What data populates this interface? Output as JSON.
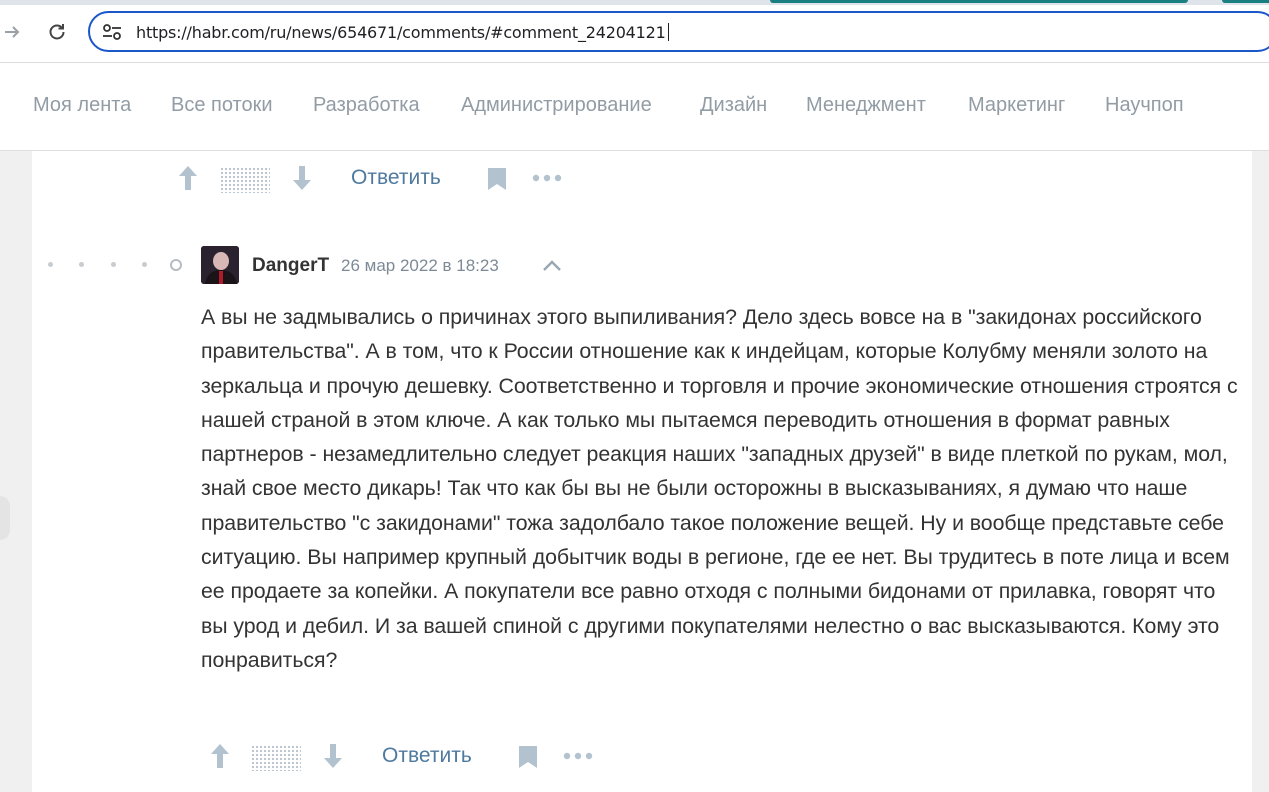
{
  "browser": {
    "url": "https://habr.com/ru/news/654671/comments/#comment_24204121",
    "icons": {
      "forward": "forward-arrow-icon",
      "reload": "reload-icon",
      "site_info": "tune-icon"
    }
  },
  "nav": {
    "items": [
      {
        "label": "Моя лента"
      },
      {
        "label": "Все потоки"
      },
      {
        "label": "Разработка"
      },
      {
        "label": "Администрирование"
      },
      {
        "label": "Дизайн"
      },
      {
        "label": "Менеджмент"
      },
      {
        "label": "Маркетинг"
      },
      {
        "label": "Научпоп"
      }
    ]
  },
  "prev_comment": {
    "reply_label": "Ответить"
  },
  "comment": {
    "author": "DangerT",
    "date": "26 мар 2022 в 18:23",
    "text": "А вы не задмывались о причинах этого выпиливания? Дело здесь вовсе на в \"закидонах российского правительства\". А в том, что к России отношение как к индейцам, которые Колубму меняли золото на зеркальца и прочую дешевку. Соответственно и торговля и прочие экономические отношения строятся с нашей страной в этом ключе. А как только мы пытаемся переводить отношения в формат равных партнеров - незамедлительно следует реакция наших \"западных друзей\" в виде плеткой по рукам, мол, знай свое место дикарь! Так что как бы вы не были осторожны в высказываниях, я думаю что наше правительство \"с закидонами\" тожа задолбало такое положение вещей. Ну и вообще представьте себе ситуацию. Вы например крупный добытчик воды в регионе, где ее нет. Вы трудитесь в поте лица и всем ее продаете за копейки. А покупатели все равно отходя с полными бидонами от прилавка, говорят что вы урод и дебил. И за вашей спиной с другими покупателями нелестно о вас высказываются. Кому это понравиться?",
    "reply_label": "Ответить"
  },
  "colors": {
    "url_border": "#1a57c9",
    "nav_text": "#929ca5",
    "reply_link": "#4f7a9f",
    "icon_gray": "#b2c2ce"
  }
}
